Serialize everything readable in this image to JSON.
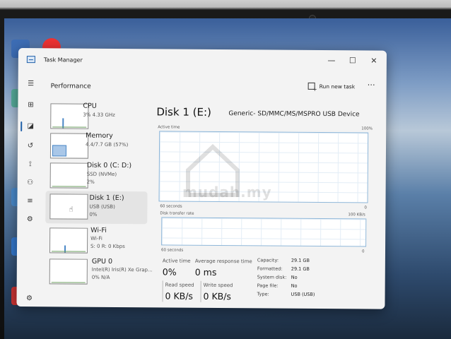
{
  "window": {
    "title": "Task Manager",
    "controls": {
      "minimize": "—",
      "maximize": "☐",
      "close": "✕"
    }
  },
  "header": {
    "page_title": "Performance",
    "run_new_task_label": "Run new task",
    "more_label": "⋯"
  },
  "nav": [
    {
      "icon": "hamburger-icon",
      "glyph": "☰"
    },
    {
      "icon": "processes-icon",
      "glyph": "⊞"
    },
    {
      "icon": "performance-icon",
      "glyph": "◪",
      "active": true
    },
    {
      "icon": "app-history-icon",
      "glyph": "↺"
    },
    {
      "icon": "startup-apps-icon",
      "glyph": "⟟"
    },
    {
      "icon": "users-icon",
      "glyph": "⚇"
    },
    {
      "icon": "details-icon",
      "glyph": "≡"
    },
    {
      "icon": "services-icon",
      "glyph": "⚙"
    },
    {
      "icon": "settings-icon",
      "glyph": "⚙"
    }
  ],
  "devices": [
    {
      "name": "CPU",
      "sub1": "3%  4.33 GHz",
      "sub2": ""
    },
    {
      "name": "Memory",
      "sub1": "4.4/7.7 GB (57%)",
      "sub2": ""
    },
    {
      "name": "Disk 0 (C: D:)",
      "sub1": "SSD (NVMe)",
      "sub2": "2%"
    },
    {
      "name": "Disk 1 (E:)",
      "sub1": "USB (USB)",
      "sub2": "0%",
      "selected": true
    },
    {
      "name": "Wi-Fi",
      "sub1": "Wi-Fi",
      "sub2": "S: 0  R: 0 Kbps"
    },
    {
      "name": "GPU 0",
      "sub1": "Intel(R) Iris(R) Xe Grap...",
      "sub2": "0%  N/A"
    }
  ],
  "detail": {
    "title": "Disk 1 (E:)",
    "model": "Generic- SD/MMC/MS/MSPRO USB Device",
    "active_time_label": "Active time",
    "active_time_max": "100%",
    "graph1_xlabel": "60 seconds",
    "graph1_min": "0",
    "transfer_label": "Disk transfer rate",
    "transfer_max": "100 KB/s",
    "graph2_xlabel": "60 seconds",
    "graph2_min": "0"
  },
  "stats": {
    "active_time_label": "Active time",
    "active_time_value": "0%",
    "avg_response_label": "Average response time",
    "avg_response_value": "0 ms",
    "read_speed_label": "Read speed",
    "read_speed_value": "0 KB/s",
    "write_speed_label": "Write speed",
    "write_speed_value": "0 KB/s"
  },
  "properties": [
    {
      "key": "Capacity:",
      "value": "29.1 GB"
    },
    {
      "key": "Formatted:",
      "value": "29.1 GB"
    },
    {
      "key": "System disk:",
      "value": "No"
    },
    {
      "key": "Page file:",
      "value": "No"
    },
    {
      "key": "Type:",
      "value": "USB (USB)"
    }
  ],
  "watermark": "mudah.my",
  "colors": {
    "accent": "#1f5fa8",
    "graph_border": "#8fb7d9"
  }
}
